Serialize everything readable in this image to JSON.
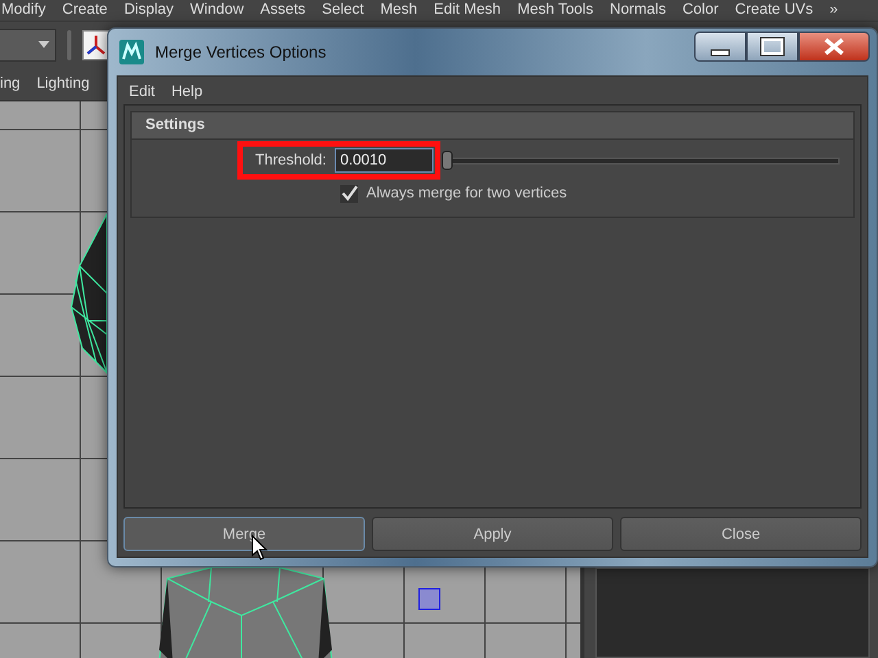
{
  "menu_bar": [
    "Modify",
    "Create",
    "Display",
    "Window",
    "Assets",
    "Select",
    "Mesh",
    "Edit Mesh",
    "Mesh Tools",
    "Normals",
    "Color",
    "Create UVs",
    "»"
  ],
  "shelf_tabs": [
    "ing",
    "Lighting"
  ],
  "dialog": {
    "title": "Merge Vertices Options",
    "menu": [
      "Edit",
      "Help"
    ],
    "section": {
      "title": "Settings",
      "threshold": {
        "label": "Threshold:",
        "value": "0.0010",
        "level": 0.0
      },
      "checkbox": {
        "label": "Always merge for two vertices",
        "checked": true
      }
    },
    "buttons": [
      {
        "label": "Merge",
        "hovered": true
      },
      {
        "label": "Apply",
        "hovered": false
      },
      {
        "label": "Close",
        "hovered": false
      }
    ]
  }
}
